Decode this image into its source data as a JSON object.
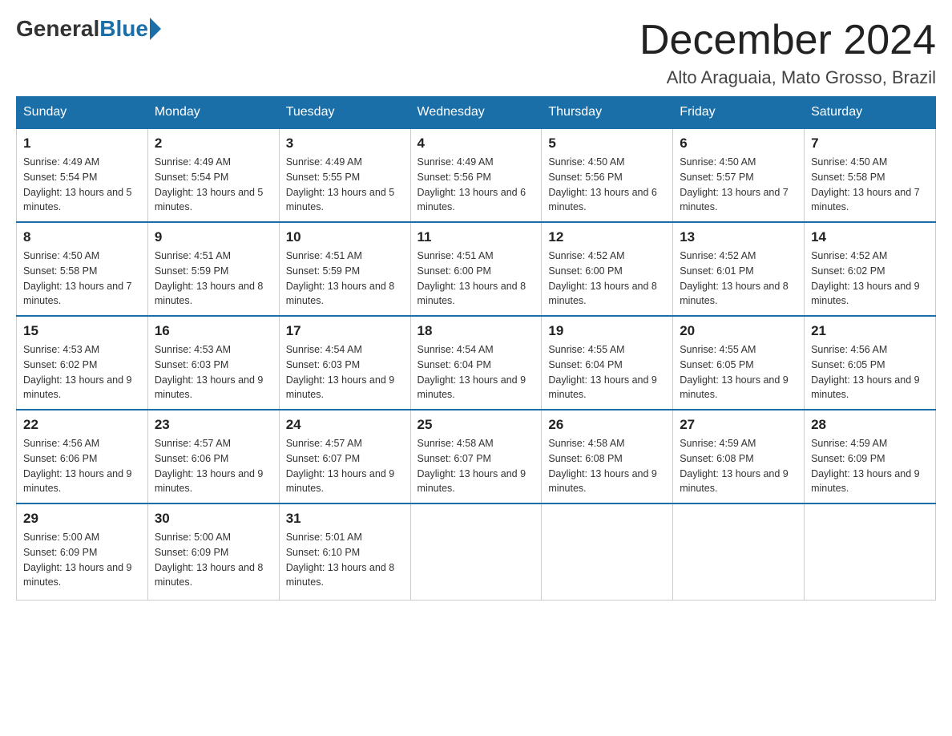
{
  "header": {
    "logo_general": "General",
    "logo_blue": "Blue",
    "title": "December 2024",
    "subtitle": "Alto Araguaia, Mato Grosso, Brazil"
  },
  "weekdays": [
    "Sunday",
    "Monday",
    "Tuesday",
    "Wednesday",
    "Thursday",
    "Friday",
    "Saturday"
  ],
  "weeks": [
    [
      {
        "day": "1",
        "sunrise": "4:49 AM",
        "sunset": "5:54 PM",
        "daylight": "13 hours and 5 minutes."
      },
      {
        "day": "2",
        "sunrise": "4:49 AM",
        "sunset": "5:54 PM",
        "daylight": "13 hours and 5 minutes."
      },
      {
        "day": "3",
        "sunrise": "4:49 AM",
        "sunset": "5:55 PM",
        "daylight": "13 hours and 5 minutes."
      },
      {
        "day": "4",
        "sunrise": "4:49 AM",
        "sunset": "5:56 PM",
        "daylight": "13 hours and 6 minutes."
      },
      {
        "day": "5",
        "sunrise": "4:50 AM",
        "sunset": "5:56 PM",
        "daylight": "13 hours and 6 minutes."
      },
      {
        "day": "6",
        "sunrise": "4:50 AM",
        "sunset": "5:57 PM",
        "daylight": "13 hours and 7 minutes."
      },
      {
        "day": "7",
        "sunrise": "4:50 AM",
        "sunset": "5:58 PM",
        "daylight": "13 hours and 7 minutes."
      }
    ],
    [
      {
        "day": "8",
        "sunrise": "4:50 AM",
        "sunset": "5:58 PM",
        "daylight": "13 hours and 7 minutes."
      },
      {
        "day": "9",
        "sunrise": "4:51 AM",
        "sunset": "5:59 PM",
        "daylight": "13 hours and 8 minutes."
      },
      {
        "day": "10",
        "sunrise": "4:51 AM",
        "sunset": "5:59 PM",
        "daylight": "13 hours and 8 minutes."
      },
      {
        "day": "11",
        "sunrise": "4:51 AM",
        "sunset": "6:00 PM",
        "daylight": "13 hours and 8 minutes."
      },
      {
        "day": "12",
        "sunrise": "4:52 AM",
        "sunset": "6:00 PM",
        "daylight": "13 hours and 8 minutes."
      },
      {
        "day": "13",
        "sunrise": "4:52 AM",
        "sunset": "6:01 PM",
        "daylight": "13 hours and 8 minutes."
      },
      {
        "day": "14",
        "sunrise": "4:52 AM",
        "sunset": "6:02 PM",
        "daylight": "13 hours and 9 minutes."
      }
    ],
    [
      {
        "day": "15",
        "sunrise": "4:53 AM",
        "sunset": "6:02 PM",
        "daylight": "13 hours and 9 minutes."
      },
      {
        "day": "16",
        "sunrise": "4:53 AM",
        "sunset": "6:03 PM",
        "daylight": "13 hours and 9 minutes."
      },
      {
        "day": "17",
        "sunrise": "4:54 AM",
        "sunset": "6:03 PM",
        "daylight": "13 hours and 9 minutes."
      },
      {
        "day": "18",
        "sunrise": "4:54 AM",
        "sunset": "6:04 PM",
        "daylight": "13 hours and 9 minutes."
      },
      {
        "day": "19",
        "sunrise": "4:55 AM",
        "sunset": "6:04 PM",
        "daylight": "13 hours and 9 minutes."
      },
      {
        "day": "20",
        "sunrise": "4:55 AM",
        "sunset": "6:05 PM",
        "daylight": "13 hours and 9 minutes."
      },
      {
        "day": "21",
        "sunrise": "4:56 AM",
        "sunset": "6:05 PM",
        "daylight": "13 hours and 9 minutes."
      }
    ],
    [
      {
        "day": "22",
        "sunrise": "4:56 AM",
        "sunset": "6:06 PM",
        "daylight": "13 hours and 9 minutes."
      },
      {
        "day": "23",
        "sunrise": "4:57 AM",
        "sunset": "6:06 PM",
        "daylight": "13 hours and 9 minutes."
      },
      {
        "day": "24",
        "sunrise": "4:57 AM",
        "sunset": "6:07 PM",
        "daylight": "13 hours and 9 minutes."
      },
      {
        "day": "25",
        "sunrise": "4:58 AM",
        "sunset": "6:07 PM",
        "daylight": "13 hours and 9 minutes."
      },
      {
        "day": "26",
        "sunrise": "4:58 AM",
        "sunset": "6:08 PM",
        "daylight": "13 hours and 9 minutes."
      },
      {
        "day": "27",
        "sunrise": "4:59 AM",
        "sunset": "6:08 PM",
        "daylight": "13 hours and 9 minutes."
      },
      {
        "day": "28",
        "sunrise": "4:59 AM",
        "sunset": "6:09 PM",
        "daylight": "13 hours and 9 minutes."
      }
    ],
    [
      {
        "day": "29",
        "sunrise": "5:00 AM",
        "sunset": "6:09 PM",
        "daylight": "13 hours and 9 minutes."
      },
      {
        "day": "30",
        "sunrise": "5:00 AM",
        "sunset": "6:09 PM",
        "daylight": "13 hours and 8 minutes."
      },
      {
        "day": "31",
        "sunrise": "5:01 AM",
        "sunset": "6:10 PM",
        "daylight": "13 hours and 8 minutes."
      },
      null,
      null,
      null,
      null
    ]
  ]
}
